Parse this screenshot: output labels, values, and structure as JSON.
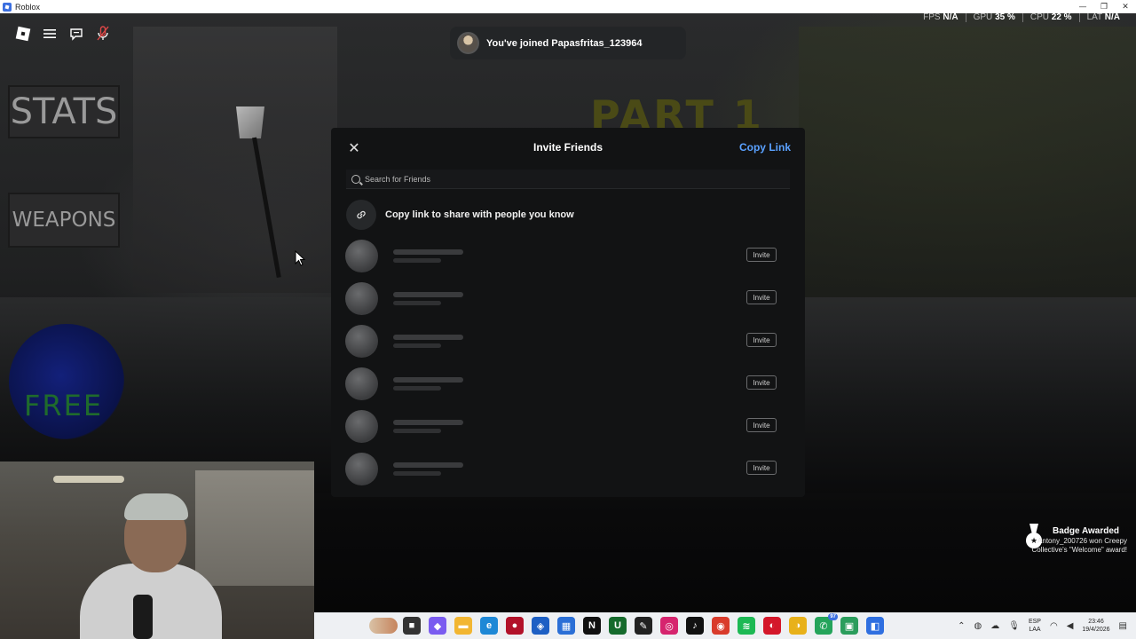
{
  "window": {
    "title": "Roblox",
    "controls": [
      "—",
      "❐",
      "✕"
    ]
  },
  "perf": [
    {
      "label": "FPS",
      "value": "N/A"
    },
    {
      "label": "GPU",
      "value": "35 %"
    },
    {
      "label": "CPU",
      "value": "22 %"
    },
    {
      "label": "LAT",
      "value": "N/A"
    }
  ],
  "toast": {
    "message": "You've joined Papasfritas_123964"
  },
  "game": {
    "stats_label": "STATS",
    "weapons_label": "WEAPONS",
    "free_label": "FREE",
    "part_label": "PART 1"
  },
  "invite": {
    "title": "Invite Friends",
    "copy_link": "Copy Link",
    "search_placeholder": "Search for Friends",
    "share_text": "Copy link to share with people you know",
    "invite_label": "Invite",
    "rows": 6
  },
  "badge": {
    "title": "Badge Awarded",
    "text": "Antony_200726 won Creepy Collective's \"Welcome\" award!"
  },
  "taskbar": {
    "lang_top": "ESP",
    "lang_bottom": "LAA",
    "time": "23:46",
    "date": "19/4/2026",
    "whatsapp_badge": "97",
    "icons": [
      {
        "name": "file-explorer-icon",
        "color": "#333333",
        "glyph": "■"
      },
      {
        "name": "copilot-icon",
        "color": "#7a5cf0",
        "glyph": "◆"
      },
      {
        "name": "folder-icon",
        "color": "#f2b632",
        "glyph": "▬"
      },
      {
        "name": "edge-icon",
        "color": "#1e88d6",
        "glyph": "e"
      },
      {
        "name": "record-app-icon",
        "color": "#b2122a",
        "glyph": "●"
      },
      {
        "name": "shield-app-icon",
        "color": "#1d5fc4",
        "glyph": "◈"
      },
      {
        "name": "store-icon",
        "color": "#2b6fd6",
        "glyph": "▦"
      },
      {
        "name": "netflix-icon",
        "color": "#111111",
        "glyph": "N"
      },
      {
        "name": "upwork-icon",
        "color": "#156a2c",
        "glyph": "U"
      },
      {
        "name": "editor-app-icon",
        "color": "#222222",
        "glyph": "✎"
      },
      {
        "name": "instagram-icon",
        "color": "#d6246e",
        "glyph": "◎"
      },
      {
        "name": "tiktok-icon",
        "color": "#111111",
        "glyph": "♪"
      },
      {
        "name": "chrome-icon",
        "color": "#d93b2b",
        "glyph": "◉"
      },
      {
        "name": "spotify-icon",
        "color": "#1db954",
        "glyph": "≋"
      },
      {
        "name": "red-app-icon",
        "color": "#d4172a",
        "glyph": "◐"
      },
      {
        "name": "yellow-app-icon",
        "color": "#e8b11a",
        "glyph": "◑"
      },
      {
        "name": "whatsapp-icon",
        "color": "#25a45b",
        "glyph": "✆"
      },
      {
        "name": "android-app-icon",
        "color": "#2a9d5c",
        "glyph": "▣"
      },
      {
        "name": "roblox-taskbar-icon",
        "color": "#2f6fe0",
        "glyph": "◧"
      }
    ]
  }
}
